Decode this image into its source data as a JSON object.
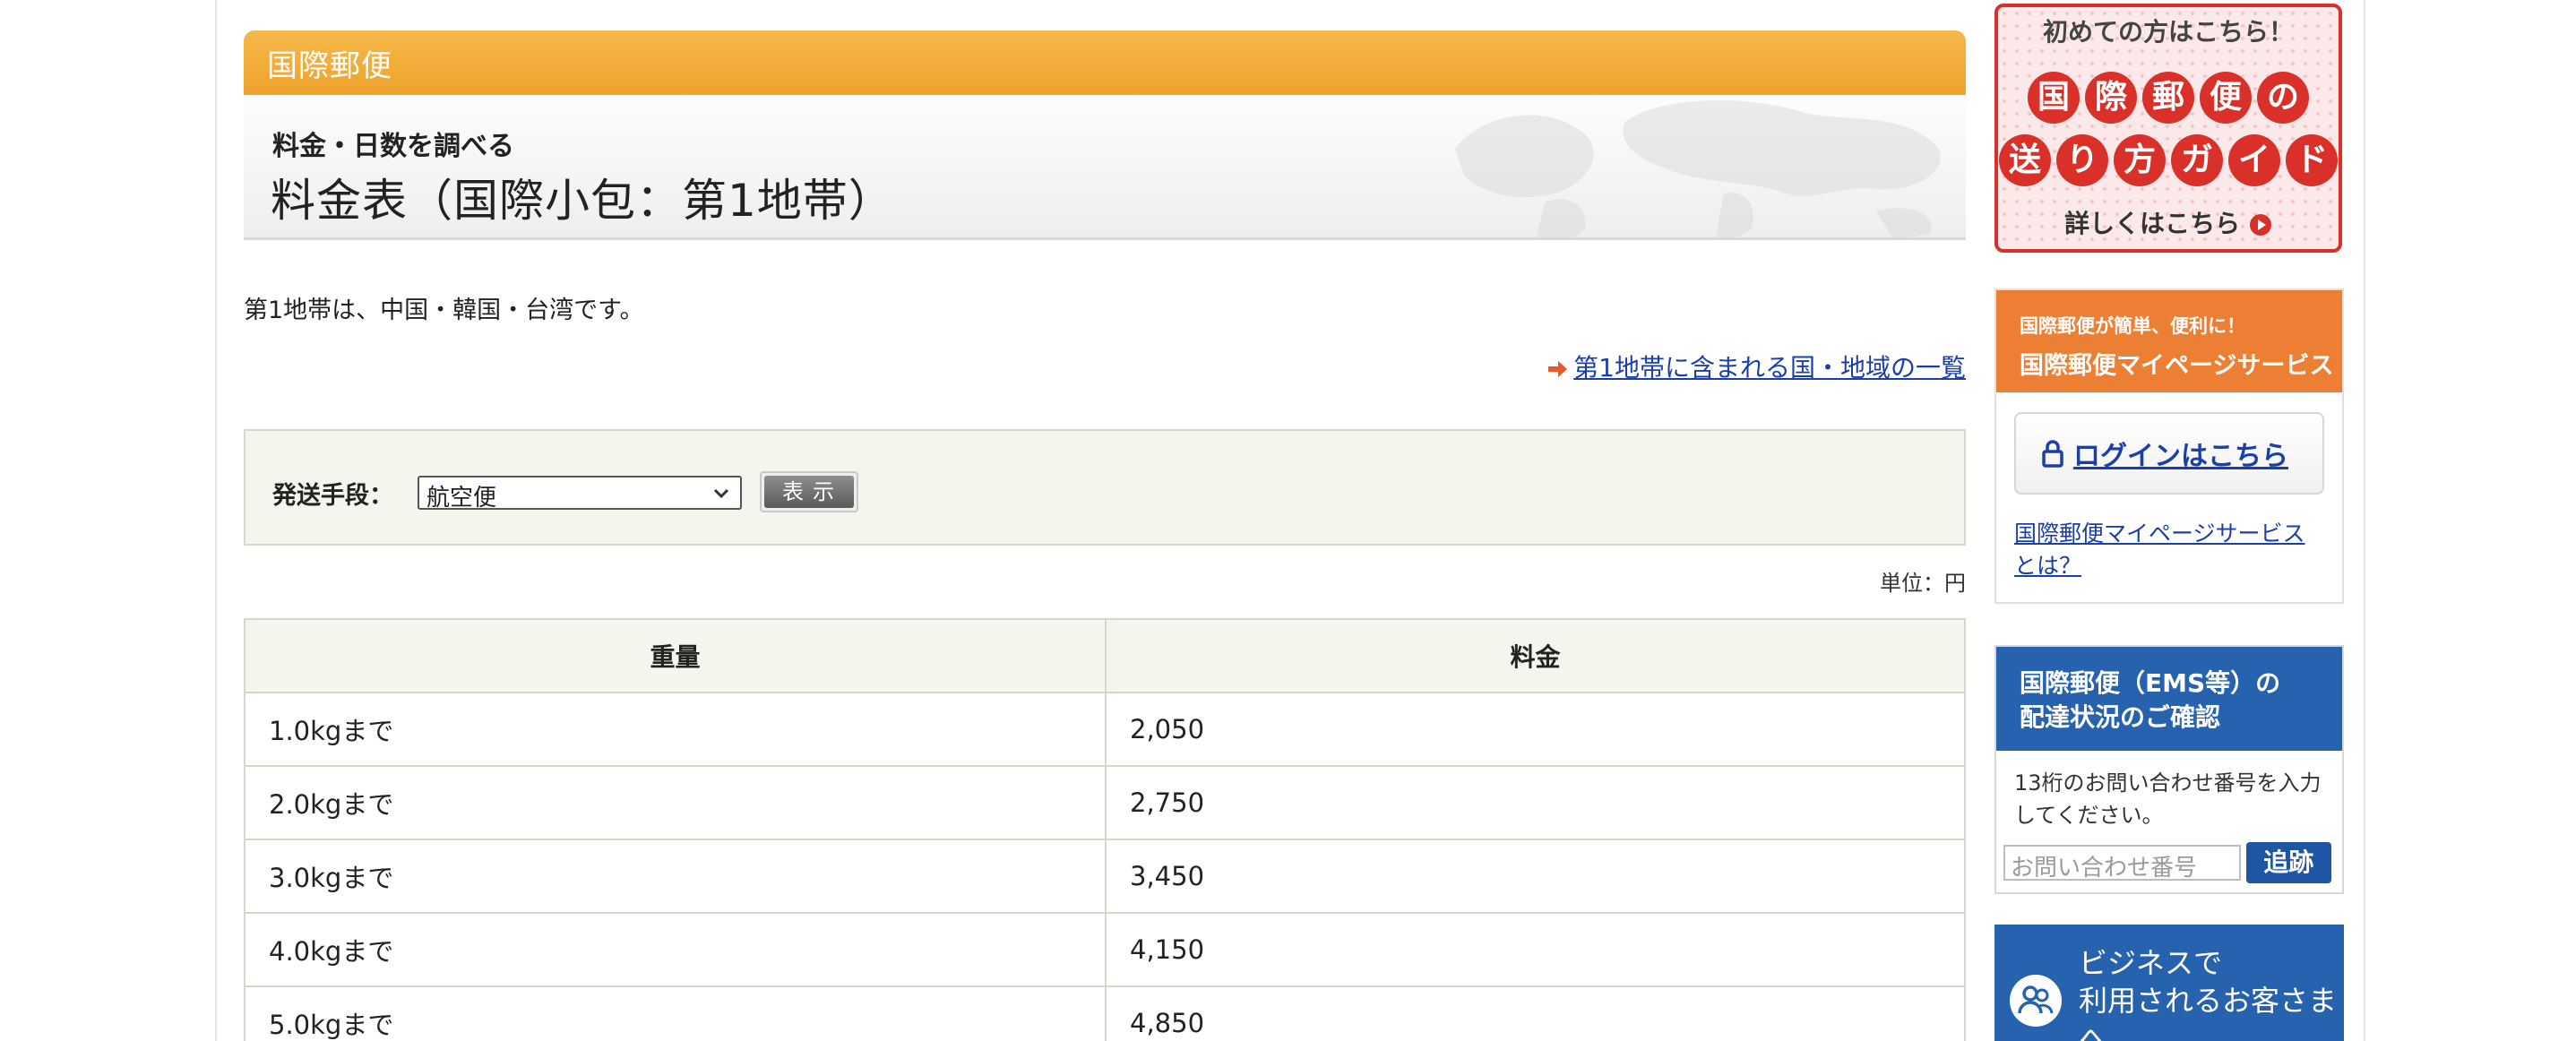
{
  "header": {
    "category": "国際郵便",
    "subtitle": "料金・日数を調べる",
    "title": "料金表（国際小包：第1地帯）"
  },
  "description": "第1地帯は、中国・韓国・台湾です。",
  "region_link": "第1地帯に含まれる国・地域の一覧",
  "filter": {
    "label": "発送手段：",
    "selected": "航空便",
    "button_label": "表示"
  },
  "unit": "単位：円",
  "table": {
    "headers": [
      "重量",
      "料金"
    ],
    "rows": [
      [
        "1.0kgまで",
        "2,050"
      ],
      [
        "2.0kgまで",
        "2,750"
      ],
      [
        "3.0kgまで",
        "3,450"
      ],
      [
        "4.0kgまで",
        "4,150"
      ],
      [
        "5.0kgまで",
        "4,850"
      ]
    ]
  },
  "sidebar": {
    "guide": {
      "top": "初めての方はこちら！",
      "line1": [
        "国",
        "際",
        "郵",
        "便",
        "の"
      ],
      "line2": [
        "送",
        "り",
        "方",
        "ガ",
        "イ",
        "ド"
      ],
      "bottom": "詳しくはこちら"
    },
    "mypage": {
      "small": "国際郵便が簡単、便利に！",
      "title": "国際郵便マイページサービス",
      "login": "ログインはこちら",
      "about": "国際郵便マイページサービスとは？"
    },
    "tracking": {
      "title_line1": "国際郵便（EMS等）の",
      "title_line2": "配達状況のご確認",
      "note": "13桁のお問い合わせ番号を入力してください。",
      "placeholder": "お問い合わせ番号",
      "button": "追跡"
    },
    "business": {
      "line1": "ビジネスで",
      "line2": "利用されるお客さまへ"
    }
  },
  "colors": {
    "header_orange": "#f0a52e",
    "mypage_orange": "#ec7f34",
    "track_blue": "#2762ae",
    "guide_red": "#d9312a",
    "link_blue": "#1b3fa8"
  }
}
